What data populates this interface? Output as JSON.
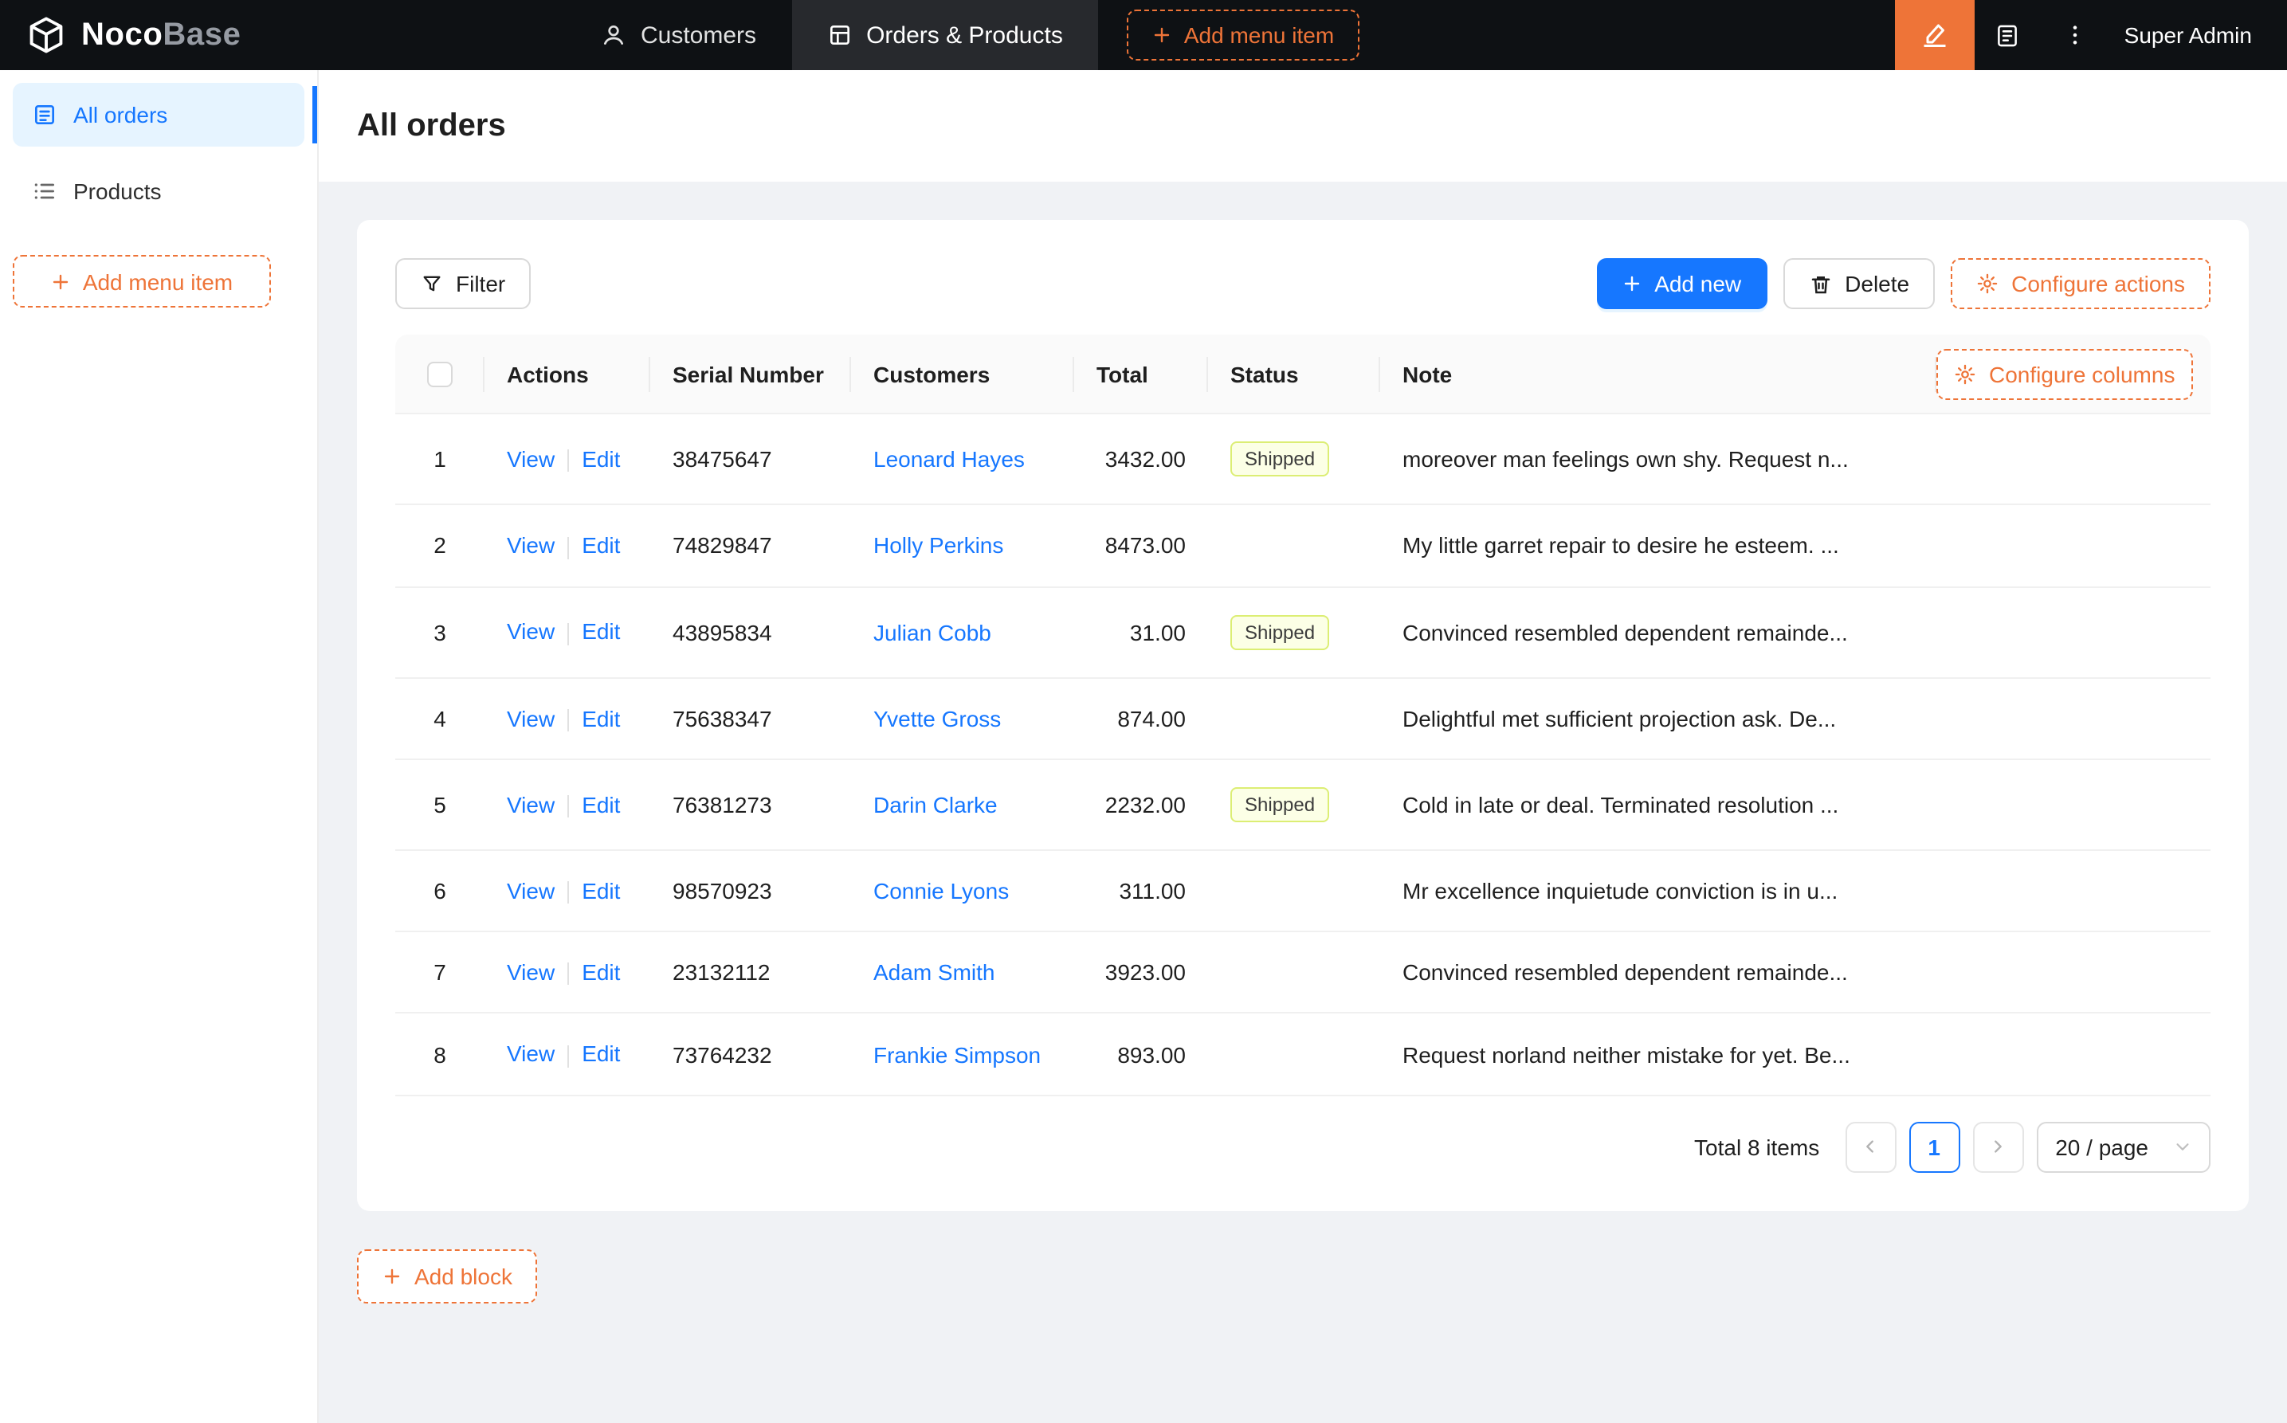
{
  "colors": {
    "accent_orange": "#ee7438",
    "primary_blue": "#1677ff",
    "navbar_bg": "#0e1114",
    "navbar_active_bg": "#27292d",
    "sidebar_active_bg": "#e6f4ff",
    "status_shipped_bg": "#fcffe6",
    "status_shipped_border": "#dcee74",
    "status_shipped_text": "#3d3d3d",
    "content_bg": "#f0f2f5"
  },
  "navbar": {
    "logo_primary": "Noco",
    "logo_secondary": "Base",
    "menu": [
      {
        "label": "Customers"
      },
      {
        "label": "Orders & Products"
      }
    ],
    "add_menu_item": "Add menu item",
    "user_name": "Super Admin"
  },
  "sidebar": {
    "items": [
      {
        "label": "All orders"
      },
      {
        "label": "Products"
      }
    ],
    "add_menu_item": "Add menu item"
  },
  "page": {
    "title": "All orders"
  },
  "toolbar": {
    "filter": "Filter",
    "add_new": "Add new",
    "delete": "Delete",
    "configure_actions": "Configure actions"
  },
  "table": {
    "columns": {
      "actions": "Actions",
      "serial": "Serial Number",
      "customers": "Customers",
      "total": "Total",
      "status": "Status",
      "note": "Note"
    },
    "configure_columns": "Configure columns",
    "row_actions": {
      "view": "View",
      "edit": "Edit"
    },
    "rows": [
      {
        "index": "1",
        "serial": "38475647",
        "customer": "Leonard Hayes",
        "total": "3432.00",
        "status": "Shipped",
        "note": "moreover man feelings own shy. Request n..."
      },
      {
        "index": "2",
        "serial": "74829847",
        "customer": "Holly Perkins",
        "total": "8473.00",
        "status": "",
        "note": "My little garret repair to desire he esteem. ..."
      },
      {
        "index": "3",
        "serial": "43895834",
        "customer": "Julian Cobb",
        "total": "31.00",
        "status": "Shipped",
        "note": "Convinced resembled dependent remainde..."
      },
      {
        "index": "4",
        "serial": "75638347",
        "customer": "Yvette Gross",
        "total": "874.00",
        "status": "",
        "note": "Delightful met sufficient projection ask. De..."
      },
      {
        "index": "5",
        "serial": "76381273",
        "customer": "Darin Clarke",
        "total": "2232.00",
        "status": "Shipped",
        "note": "Cold in late or deal. Terminated resolution ..."
      },
      {
        "index": "6",
        "serial": "98570923",
        "customer": "Connie Lyons",
        "total": "311.00",
        "status": "",
        "note": "Mr excellence inquietude conviction is in u..."
      },
      {
        "index": "7",
        "serial": "23132112",
        "customer": "Adam Smith",
        "total": "3923.00",
        "status": "",
        "note": "Convinced resembled dependent remainde..."
      },
      {
        "index": "8",
        "serial": "73764232",
        "customer": "Frankie Simpson",
        "total": "893.00",
        "status": "",
        "note": "Request norland neither mistake for yet. Be..."
      }
    ]
  },
  "pagination": {
    "total_text": "Total 8 items",
    "current_page": "1",
    "page_size": "20 / page"
  },
  "footer": {
    "add_block": "Add block"
  }
}
